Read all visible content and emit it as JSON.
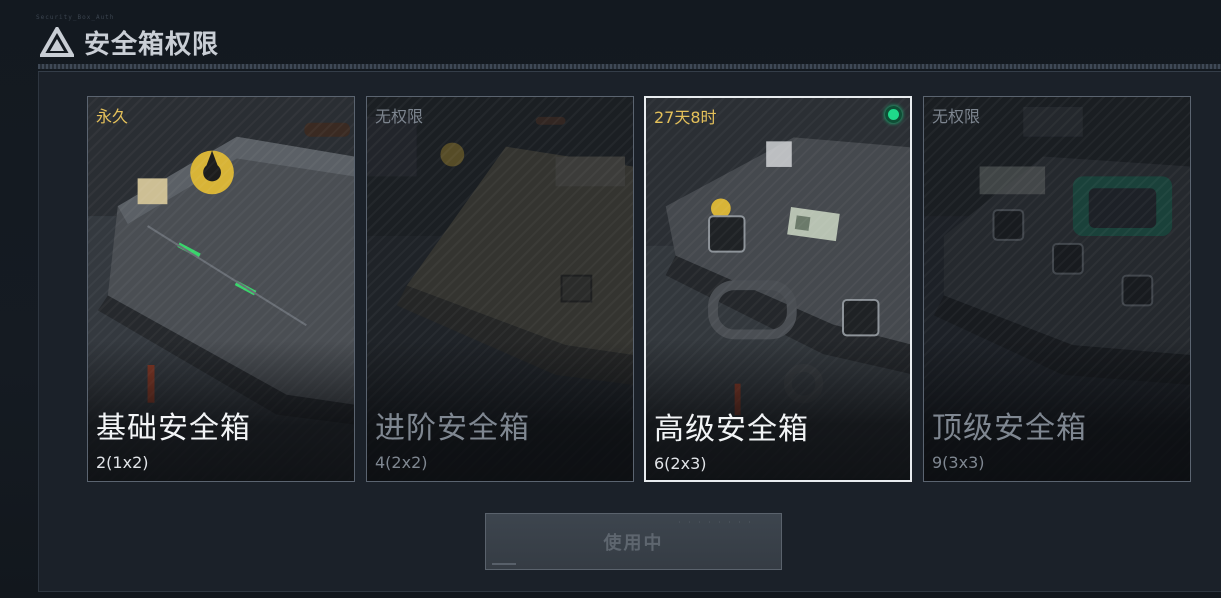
{
  "header": {
    "title": "安全箱权限",
    "code": "Security_Box_Auth"
  },
  "cards": [
    {
      "name": "基础安全箱",
      "capacity": "2(1x2)",
      "tag": "永久",
      "locked": false,
      "selected": false
    },
    {
      "name": "进阶安全箱",
      "capacity": "4(2x2)",
      "tag": "无权限",
      "locked": true,
      "selected": false
    },
    {
      "name": "高级安全箱",
      "capacity": "6(2x3)",
      "tag": "27天8时",
      "locked": false,
      "selected": true
    },
    {
      "name": "顶级安全箱",
      "capacity": "9(3x3)",
      "tag": "无权限",
      "locked": true,
      "selected": false
    }
  ],
  "action": {
    "label": "使用中",
    "enabled": false
  },
  "colors": {
    "tag_active": "#e5c15a",
    "tag_locked": "#7d858f",
    "selected_border": "#e8ecef",
    "active_dot": "#1fd98a"
  }
}
